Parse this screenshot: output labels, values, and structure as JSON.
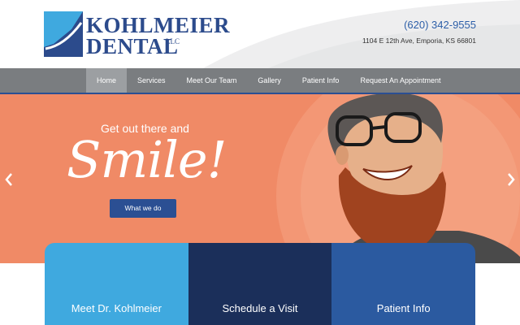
{
  "brand": {
    "name_line1": "KOHLMEIER",
    "name_line2": "DENTAL",
    "suffix": "LLC",
    "primary_color": "#2c4b8c",
    "accent_color": "#3fa9df"
  },
  "contact": {
    "phone": "(620) 342-9555",
    "address": "1104 E 12th Ave, Emporia, KS 66801"
  },
  "nav": {
    "items": [
      {
        "label": "Home",
        "active": true
      },
      {
        "label": "Services",
        "active": false
      },
      {
        "label": "Meet Our Team",
        "active": false
      },
      {
        "label": "Gallery",
        "active": false
      },
      {
        "label": "Patient Info",
        "active": false
      },
      {
        "label": "Request An Appointment",
        "active": false
      }
    ]
  },
  "hero": {
    "tagline": "Get out there and",
    "headline": "Smile!",
    "button_label": "What we do",
    "background_color": "#f08a66",
    "prev_icon": "chevron-left-icon",
    "next_icon": "chevron-right-icon"
  },
  "cards": [
    {
      "label": "Meet Dr. Kohlmeier",
      "color": "#3fa9df"
    },
    {
      "label": "Schedule a Visit",
      "color": "#1b2f5a"
    },
    {
      "label": "Patient Info",
      "color": "#2b5aa0"
    }
  ]
}
